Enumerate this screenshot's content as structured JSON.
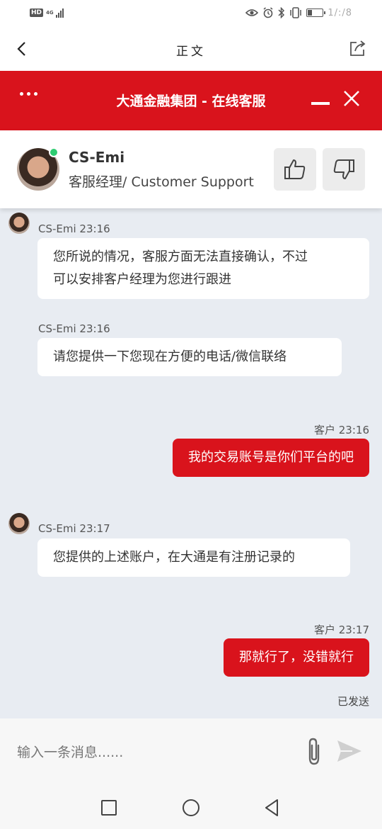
{
  "status_bar": {
    "hd": "HD",
    "network": "4G",
    "clock": "1/:/8"
  },
  "nav": {
    "title": "正文"
  },
  "chat_header": {
    "title": "大通金融集团 - 在线客服"
  },
  "agent": {
    "name": "CS-Emi",
    "role": "客服经理/ Customer Support",
    "online": true
  },
  "messages": [
    {
      "sender": "agent",
      "meta": "CS-Emi 23:16",
      "text_lines": [
        "您所说的情况，客服方面无法直接确认，不过",
        "可以安排客户经理为您进行跟进"
      ]
    },
    {
      "sender": "agent",
      "meta": "CS-Emi 23:16",
      "text_lines": [
        "请您提供一下您现在方便的电话/微信联络"
      ]
    },
    {
      "sender": "user",
      "meta": "客户 23:16",
      "text_lines": [
        "我的交易账号是你们平台的吧"
      ]
    },
    {
      "sender": "agent",
      "meta": "CS-Emi 23:17",
      "text_lines": [
        "您提供的上述账户，在大通是有注册记录的"
      ]
    },
    {
      "sender": "user",
      "meta": "客户 23:17",
      "text_lines": [
        "那就行了，没错就行"
      ]
    }
  ],
  "sent_status": "已发送",
  "input": {
    "placeholder": "输入一条消息......"
  },
  "colors": {
    "brand_red": "#d9131c",
    "chat_background": "#e8ecf2",
    "online": "#2ecc71"
  },
  "icons": [
    "back-icon",
    "share-icon",
    "more-icon",
    "minimize-icon",
    "close-icon",
    "thumbs-up-icon",
    "thumbs-down-icon",
    "paperclip-icon",
    "send-icon"
  ]
}
